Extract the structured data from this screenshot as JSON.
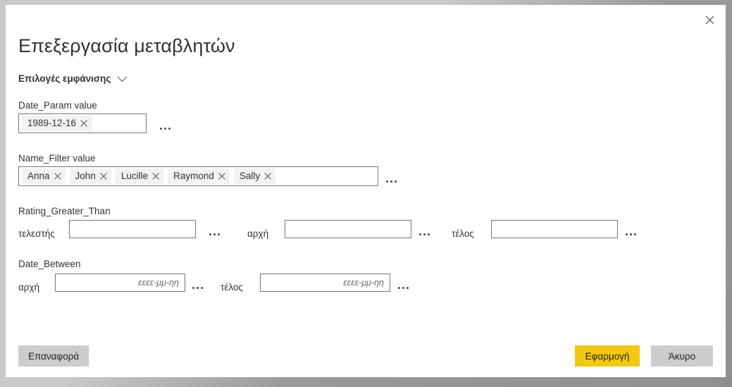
{
  "dialog": {
    "title": "Επεξεργασία μεταβλητών",
    "close_icon": "close-icon",
    "display_options": {
      "label": "Επιλογές εμφάνισης",
      "chevron_icon": "chevron-down-icon"
    }
  },
  "fields": [
    {
      "id": "date-param",
      "label": "Date_Param value",
      "type": "tokens",
      "tokens": [
        "1989-12-16"
      ],
      "overflow_label": "…"
    },
    {
      "id": "name-filter",
      "label": "Name_Filter value",
      "type": "tokens",
      "tokens": [
        "Anna",
        "John",
        "Lucille",
        "Raymond",
        "Sally"
      ],
      "overflow_label": "…"
    },
    {
      "id": "rating-greater-than",
      "label": "Rating_Greater_Than",
      "type": "inline-group",
      "parts": [
        {
          "label": "τελεστής",
          "value": "",
          "placeholder": ""
        },
        {
          "label": "αρχή",
          "value": "",
          "placeholder": ""
        },
        {
          "label": "τέλος",
          "value": "",
          "placeholder": ""
        }
      ]
    },
    {
      "id": "date-between",
      "label": "Date_Between",
      "type": "inline-group",
      "parts": [
        {
          "label": "αρχή",
          "value": "",
          "placeholder": "εεεε-μμ-ηη"
        },
        {
          "label": "τέλος",
          "value": "",
          "placeholder": "εεεε-μμ-ηη"
        }
      ]
    }
  ],
  "footer": {
    "reset_label": "Επαναφορά",
    "apply_label": "Εφαρμογή",
    "cancel_label": "Άκυρο"
  },
  "colors": {
    "accent_yellow": "#f2c811",
    "button_grey": "#cccccc",
    "token_bg": "#f3f2f1",
    "border": "#767676",
    "text": "#333333",
    "frame_light": "#c9c9c9",
    "frame_dark": "#8f8f8f"
  }
}
